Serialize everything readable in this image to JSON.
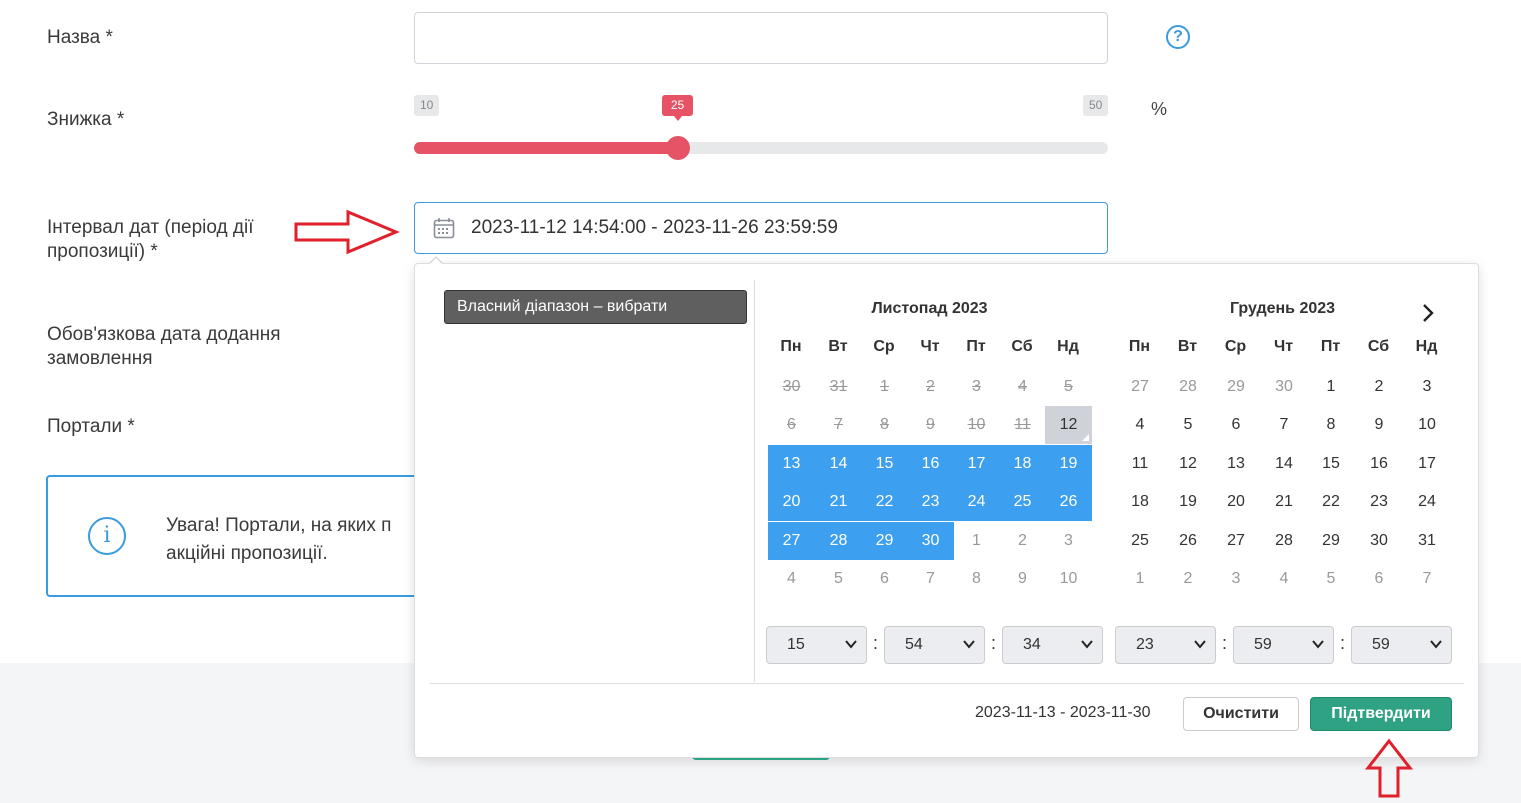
{
  "form": {
    "name_label": "Назва *",
    "name_value": "",
    "help_glyph": "?",
    "discount_label": "Знижка *",
    "discount": {
      "min": "10",
      "max": "50",
      "value": "25",
      "value_number": 25,
      "min_number": 10,
      "max_number": 50,
      "unit": "%"
    },
    "interval_label": "Інтервал дат (період дії пропозиції) *",
    "interval_value": "2023-11-12 14:54:00 - 2023-11-26 23:59:59",
    "required_date_label": "Обов'язкова дата додання замовлення",
    "portals_label": "Портали *",
    "alert_text": "Увага! Портали, на яких п\nакційні пропозиції.",
    "info_glyph": "i"
  },
  "picker": {
    "custom_range_label": "Власний діапазон – вибрати",
    "next_glyph": "›",
    "months": [
      {
        "title": "Листопад 2023",
        "dow": [
          "Пн",
          "Вт",
          "Ср",
          "Чт",
          "Пт",
          "Сб",
          "Нд"
        ],
        "weeks": [
          [
            {
              "d": "30",
              "s": "disabled"
            },
            {
              "d": "31",
              "s": "disabled"
            },
            {
              "d": "1",
              "s": "disabled"
            },
            {
              "d": "2",
              "s": "disabled"
            },
            {
              "d": "3",
              "s": "disabled"
            },
            {
              "d": "4",
              "s": "disabled"
            },
            {
              "d": "5",
              "s": "disabled"
            }
          ],
          [
            {
              "d": "6",
              "s": "disabled"
            },
            {
              "d": "7",
              "s": "disabled"
            },
            {
              "d": "8",
              "s": "disabled"
            },
            {
              "d": "9",
              "s": "disabled"
            },
            {
              "d": "10",
              "s": "disabled"
            },
            {
              "d": "11",
              "s": "disabled"
            },
            {
              "d": "12",
              "s": "start"
            }
          ],
          [
            {
              "d": "13",
              "s": "in-range"
            },
            {
              "d": "14",
              "s": "in-range"
            },
            {
              "d": "15",
              "s": "in-range"
            },
            {
              "d": "16",
              "s": "in-range"
            },
            {
              "d": "17",
              "s": "in-range"
            },
            {
              "d": "18",
              "s": "in-range"
            },
            {
              "d": "19",
              "s": "in-range"
            }
          ],
          [
            {
              "d": "20",
              "s": "in-range"
            },
            {
              "d": "21",
              "s": "in-range"
            },
            {
              "d": "22",
              "s": "in-range"
            },
            {
              "d": "23",
              "s": "in-range"
            },
            {
              "d": "24",
              "s": "in-range"
            },
            {
              "d": "25",
              "s": "in-range"
            },
            {
              "d": "26",
              "s": "in-range"
            }
          ],
          [
            {
              "d": "27",
              "s": "in-range"
            },
            {
              "d": "28",
              "s": "in-range"
            },
            {
              "d": "29",
              "s": "in-range"
            },
            {
              "d": "30",
              "s": "in-range"
            },
            {
              "d": "1",
              "s": "off"
            },
            {
              "d": "2",
              "s": "off"
            },
            {
              "d": "3",
              "s": "off"
            }
          ],
          [
            {
              "d": "4",
              "s": "off"
            },
            {
              "d": "5",
              "s": "off"
            },
            {
              "d": "6",
              "s": "off"
            },
            {
              "d": "7",
              "s": "off"
            },
            {
              "d": "8",
              "s": "off"
            },
            {
              "d": "9",
              "s": "off"
            },
            {
              "d": "10",
              "s": "off"
            }
          ]
        ]
      },
      {
        "title": "Грудень 2023",
        "dow": [
          "Пн",
          "Вт",
          "Ср",
          "Чт",
          "Пт",
          "Сб",
          "Нд"
        ],
        "weeks": [
          [
            {
              "d": "27",
              "s": "off"
            },
            {
              "d": "28",
              "s": "off"
            },
            {
              "d": "29",
              "s": "off"
            },
            {
              "d": "30",
              "s": "off"
            },
            {
              "d": "1",
              "s": ""
            },
            {
              "d": "2",
              "s": ""
            },
            {
              "d": "3",
              "s": ""
            }
          ],
          [
            {
              "d": "4",
              "s": ""
            },
            {
              "d": "5",
              "s": ""
            },
            {
              "d": "6",
              "s": ""
            },
            {
              "d": "7",
              "s": ""
            },
            {
              "d": "8",
              "s": ""
            },
            {
              "d": "9",
              "s": ""
            },
            {
              "d": "10",
              "s": ""
            }
          ],
          [
            {
              "d": "11",
              "s": ""
            },
            {
              "d": "12",
              "s": ""
            },
            {
              "d": "13",
              "s": ""
            },
            {
              "d": "14",
              "s": ""
            },
            {
              "d": "15",
              "s": ""
            },
            {
              "d": "16",
              "s": ""
            },
            {
              "d": "17",
              "s": ""
            }
          ],
          [
            {
              "d": "18",
              "s": ""
            },
            {
              "d": "19",
              "s": ""
            },
            {
              "d": "20",
              "s": ""
            },
            {
              "d": "21",
              "s": ""
            },
            {
              "d": "22",
              "s": ""
            },
            {
              "d": "23",
              "s": ""
            },
            {
              "d": "24",
              "s": ""
            }
          ],
          [
            {
              "d": "25",
              "s": ""
            },
            {
              "d": "26",
              "s": ""
            },
            {
              "d": "27",
              "s": ""
            },
            {
              "d": "28",
              "s": ""
            },
            {
              "d": "29",
              "s": ""
            },
            {
              "d": "30",
              "s": ""
            },
            {
              "d": "31",
              "s": ""
            }
          ],
          [
            {
              "d": "1",
              "s": "off"
            },
            {
              "d": "2",
              "s": "off"
            },
            {
              "d": "3",
              "s": "off"
            },
            {
              "d": "4",
              "s": "off"
            },
            {
              "d": "5",
              "s": "off"
            },
            {
              "d": "6",
              "s": "off"
            },
            {
              "d": "7",
              "s": "off"
            }
          ]
        ]
      }
    ],
    "start_time": {
      "hour": "15",
      "minute": "54",
      "second": "34"
    },
    "end_time": {
      "hour": "23",
      "minute": "59",
      "second": "59"
    },
    "time_separator": ":",
    "selected_range_text": "2023-11-13 - 2023-11-30",
    "clear_label": "Очистити",
    "confirm_label": "Підтвердити"
  },
  "colors": {
    "accent_blue": "#3d9ff0",
    "slider_red": "#e65266",
    "confirm_green": "#2fa284",
    "annotation_red": "#e0202a"
  }
}
